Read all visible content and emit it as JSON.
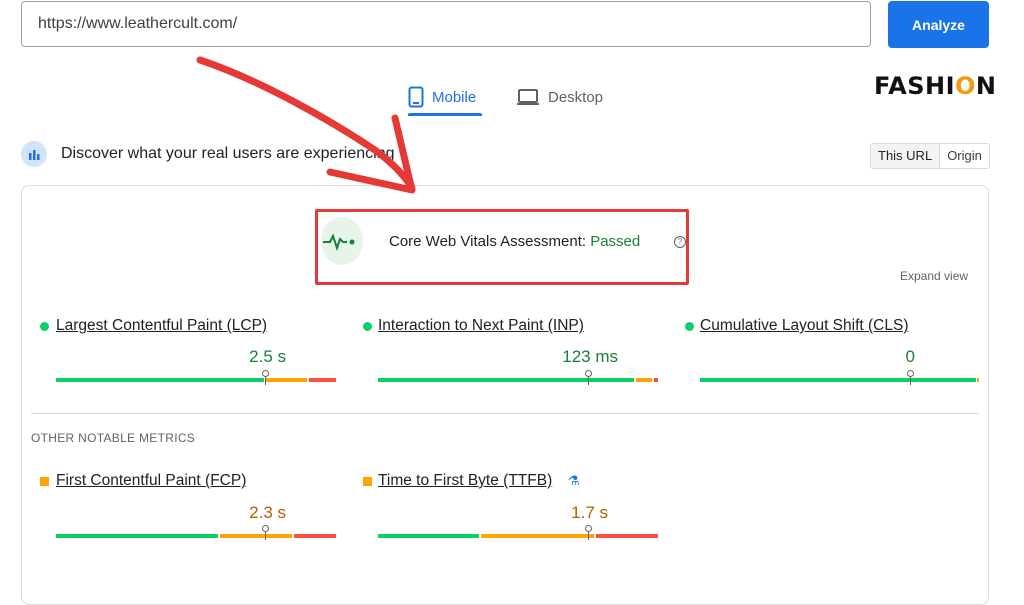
{
  "search": {
    "url": "https://www.leathercult.com/",
    "analyze_label": "Analyze"
  },
  "tabs": [
    {
      "label": "Mobile",
      "active": true,
      "icon": "smartphone-icon"
    },
    {
      "label": "Desktop",
      "active": false,
      "icon": "laptop-icon"
    }
  ],
  "logo": {
    "prefix": "FASHI",
    "o": "O",
    "suffix": "N"
  },
  "discover": {
    "text": "Discover what your real users are experiencing",
    "toggle": [
      "This URL",
      "Origin"
    ]
  },
  "assessment": {
    "label": "Core Web Vitals Assessment:",
    "status": "Passed",
    "expand_label": "Expand view"
  },
  "core_metrics": [
    {
      "name": "Largest Contentful Paint (LCP)",
      "value": "2.5 s",
      "rating": "good"
    },
    {
      "name": "Interaction to Next Paint (INP)",
      "value": "123 ms",
      "rating": "good"
    },
    {
      "name": "Cumulative Layout Shift (CLS)",
      "value": "0",
      "rating": "good"
    }
  ],
  "other_label": "OTHER NOTABLE METRICS",
  "other_metrics": [
    {
      "name": "First Contentful Paint (FCP)",
      "value": "2.3 s",
      "rating": "needs-improvement"
    },
    {
      "name": "Time to First Byte (TTFB)",
      "value": "1.7 s",
      "rating": "needs-improvement",
      "experimental": true
    }
  ],
  "colors": {
    "accent": "#1a73e8",
    "good": "#0cce6b",
    "needs_improvement": "#ffa400",
    "poor": "#ff4e42",
    "annotation": "#e53935"
  }
}
